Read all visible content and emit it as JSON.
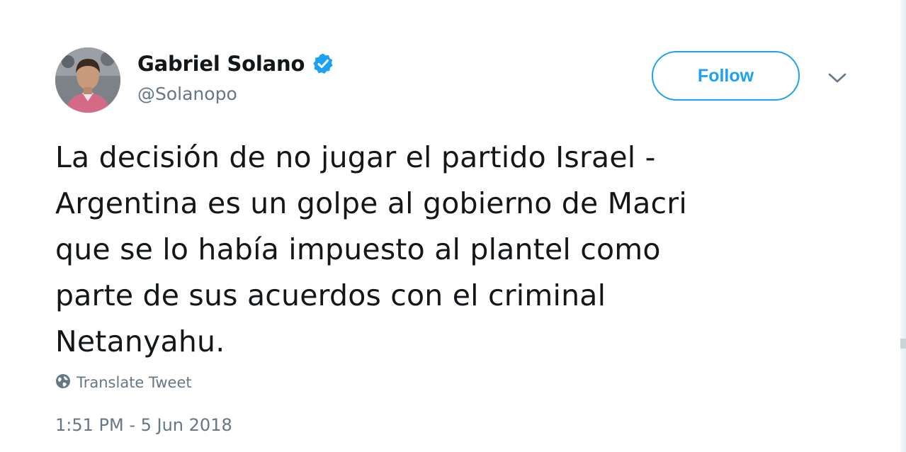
{
  "user": {
    "display_name": "Gabriel Solano",
    "handle": "@Solanopo",
    "verified": true
  },
  "actions": {
    "follow_label": "Follow",
    "more_icon": "chevron-down-icon"
  },
  "tweet": {
    "lines": [
      "La decisión de no jugar el partido Israel -",
      "Argentina es un golpe al gobierno de Macri",
      "que se lo había impuesto al plantel como",
      "parte de sus acuerdos con el criminal",
      "Netanyahu."
    ],
    "translate_label": "Translate Tweet",
    "translate_icon": "globe-icon",
    "timestamp": "1:51 PM - 5 Jun 2018"
  },
  "colors": {
    "accent": "#1da1f2",
    "text": "#14171a",
    "secondary": "#657786"
  }
}
